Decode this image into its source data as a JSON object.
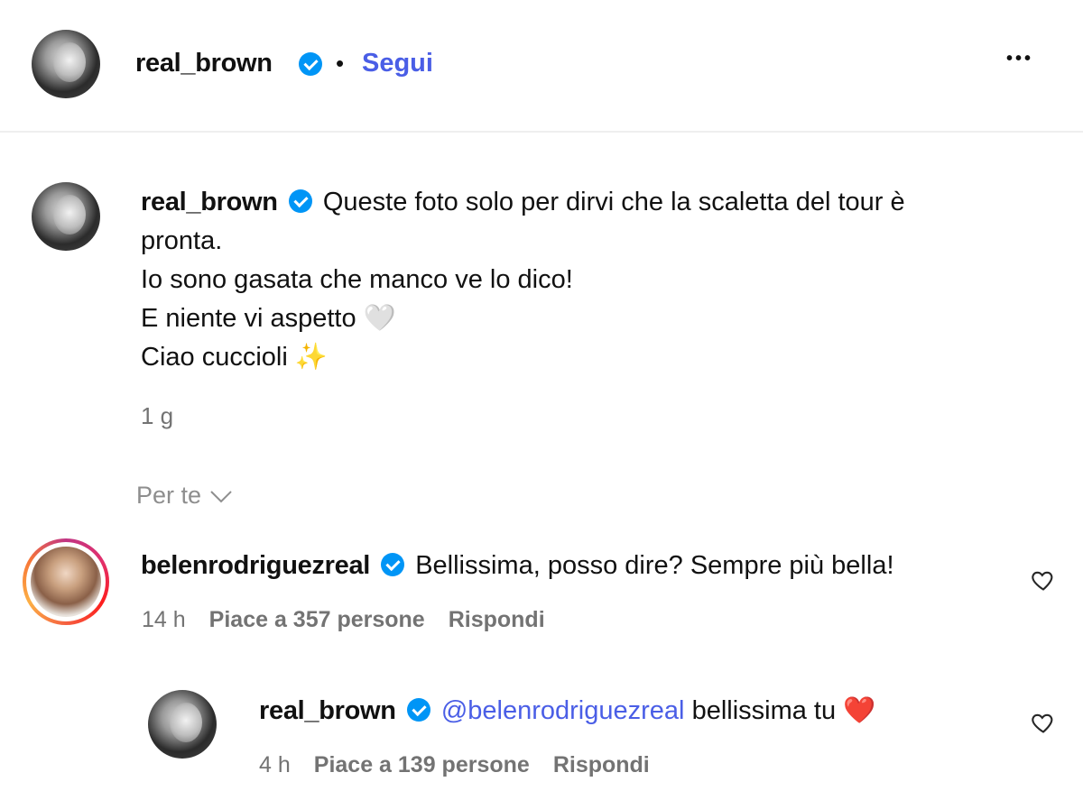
{
  "header": {
    "username": "real_brown",
    "separator": "•",
    "follow_label": "Segui",
    "more_label": "•••",
    "avatar_icon": "profile-avatar-icon",
    "verified_icon": "verified-badge-icon"
  },
  "caption": {
    "username": "real_brown",
    "line1": "Queste foto solo per dirvi che la scaletta del tour è",
    "line2": "pronta.",
    "line3": "Io sono gasata che manco ve lo dico!",
    "line4": "E niente vi aspetto",
    "line4_emoji": "🤍",
    "line5": "Ciao cuccioli",
    "line5_emoji": "✨",
    "time": "1 g"
  },
  "sort": {
    "label": "Per te",
    "icon": "chevron-down-icon"
  },
  "comments": [
    {
      "username": "belenrodriguezreal",
      "text": "Bellissima, posso dire? Sempre più bella!",
      "time": "14 h",
      "likes": "Piace a 357 persone",
      "reply": "Rispondi"
    }
  ],
  "replies": [
    {
      "username": "real_brown",
      "mention": "@belenrodriguezreal",
      "text": "bellissima tu",
      "emoji": "❤️",
      "time": "4 h",
      "likes": "Piace a 139 persone",
      "reply": "Rispondi"
    }
  ],
  "colors": {
    "accent": "#4a5ee6",
    "verified": "#0095f6",
    "muted": "#737373"
  }
}
